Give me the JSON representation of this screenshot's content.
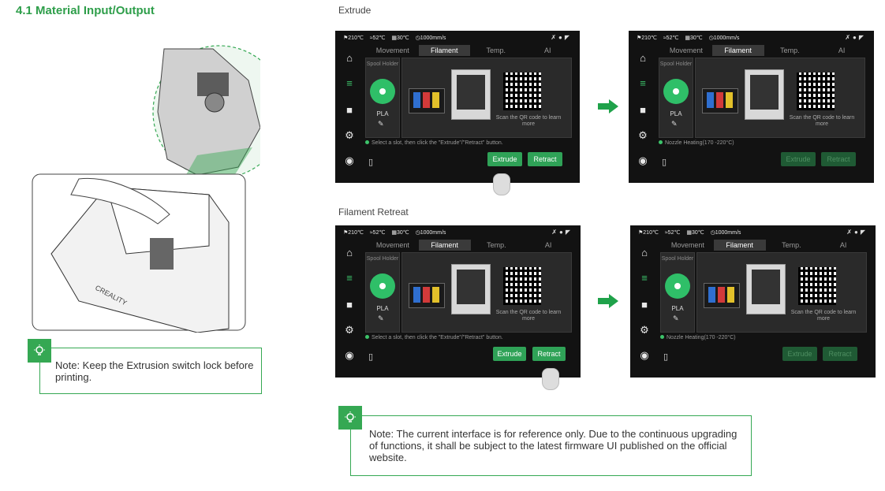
{
  "section_title": "4.1 Material Input/Output",
  "captions": {
    "extrude": "Extrude",
    "retreat": "Filament Retreat"
  },
  "note_left": "Note: Keep the Extrusion switch lock before printing.",
  "note_bottom": "Note: The current interface is for reference only. Due to the continuous upgrading of functions, it shall be subject to the latest firmware UI published on the official website.",
  "screen": {
    "status": {
      "nozzle": "210℃",
      "bed": "52℃",
      "chamber": "30℃",
      "speed": "1000mm/s"
    },
    "tabs": [
      "Movement",
      "Filament",
      "Temp.",
      "AI"
    ],
    "spool_holder": "Spool Holder",
    "material": "PLA",
    "scan_text": "Scan the QR code to learn more",
    "hint_select": "Select a slot, then click the \"Extrude\"/\"Retract\" button.",
    "hint_heating": "Nozzle Heating(170 -220°C)",
    "extrude_label": "Extrude",
    "retract_label": "Retract"
  },
  "colors": {
    "accent": "#2e9e4a",
    "slot_colors": [
      "#2f6fd0",
      "#d23a3a",
      "#e2c02a"
    ]
  }
}
